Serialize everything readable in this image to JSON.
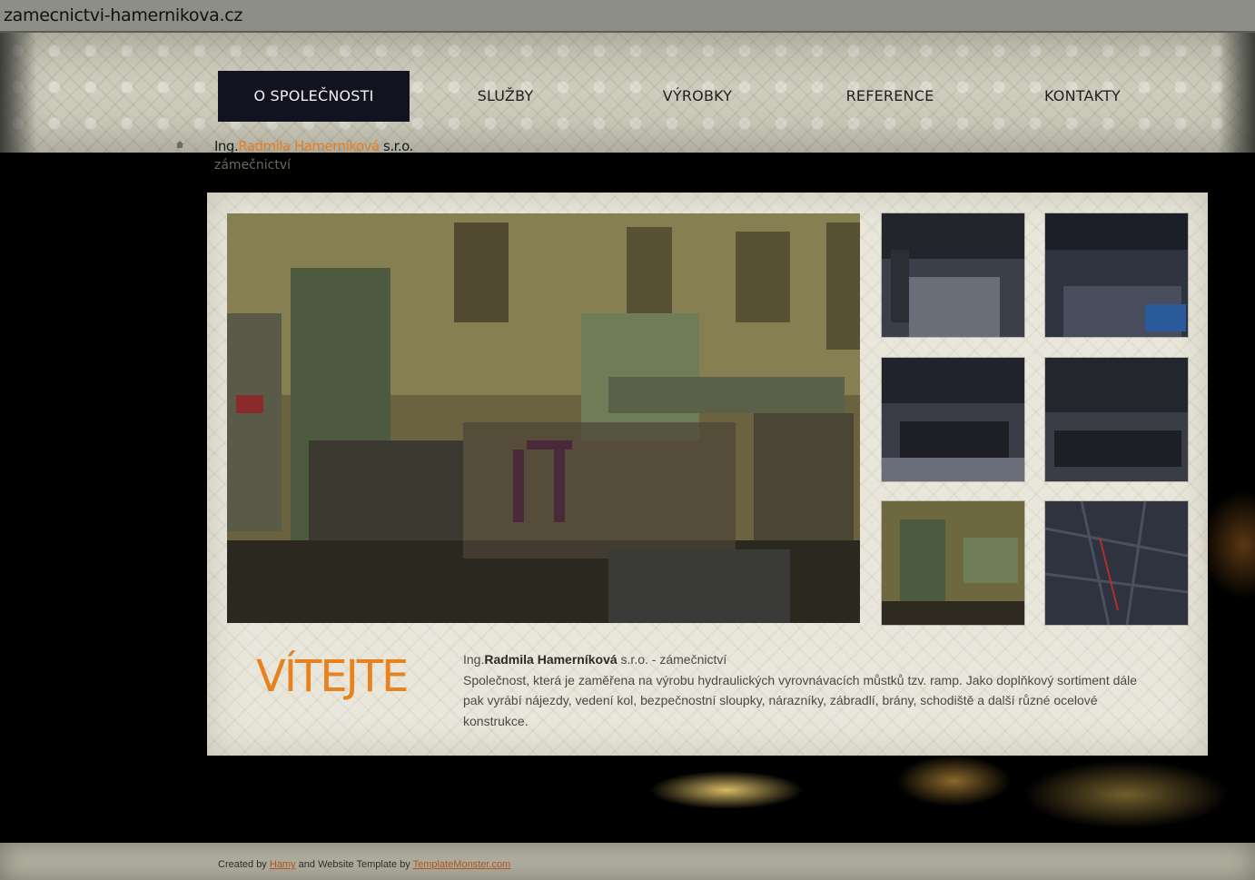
{
  "window": {
    "title": "zamecnictvi-hamernikova.cz"
  },
  "nav": {
    "items": [
      {
        "label": "O SPOLEČNOSTI",
        "active": true
      },
      {
        "label": "SLUŽBY",
        "active": false
      },
      {
        "label": "VÝROBKY",
        "active": false
      },
      {
        "label": "REFERENCE",
        "active": false
      },
      {
        "label": "KONTAKTY",
        "active": false
      }
    ]
  },
  "brand": {
    "prefix": "Ing.",
    "name": "Radmila Hamerníková",
    "suffix": " s.r.o.",
    "subtitle": "zámečnictví"
  },
  "gallery": {
    "thumbs": [
      "workshop-hall-1",
      "workshop-hall-2",
      "workshop-tables-1",
      "workshop-tables-2",
      "machine-room",
      "aerial-map"
    ]
  },
  "welcome": {
    "heading": "VÍTEJTE",
    "intro_prefix": "Ing.",
    "intro_name": "Radmila Hamerníková",
    "intro_rest": " s.r.o. - zámečnictví",
    "body": "Společnost, která je zaměřena na výrobu hydraulických vyrovnávacích můstků tzv. ramp. Jako doplňkový sortiment dále pak vyrábí nájezdy, vedení kol, bezpečnostní sloupky, nárazníky, zábradlí, brány, schodiště a další různé ocelové konstrukce."
  },
  "footer": {
    "created_by": "Created by",
    "author_link": "Hamy",
    "middle": "and Website Template by",
    "template_link": "TemplateMonster.com"
  },
  "colors": {
    "accent": "#e67e22",
    "nav_active_bg": "#121220"
  }
}
